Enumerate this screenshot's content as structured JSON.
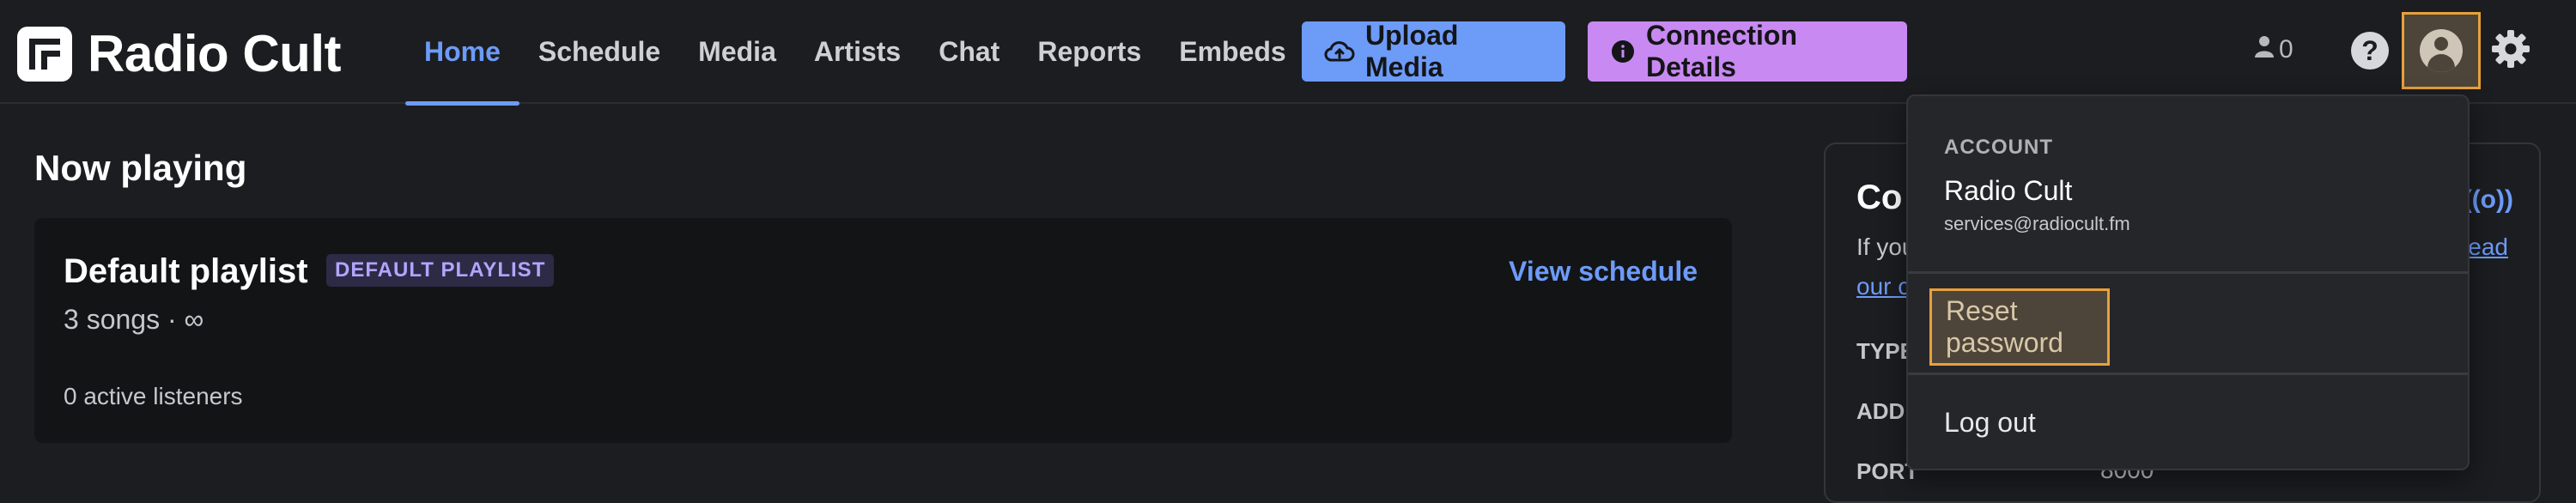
{
  "app": {
    "name": "Radio Cult"
  },
  "nav": [
    {
      "label": "Home",
      "active": true
    },
    {
      "label": "Schedule",
      "active": false
    },
    {
      "label": "Media",
      "active": false
    },
    {
      "label": "Artists",
      "active": false
    },
    {
      "label": "Chat",
      "active": false
    },
    {
      "label": "Reports",
      "active": false
    },
    {
      "label": "Embeds",
      "active": false
    }
  ],
  "actions": {
    "upload_label": "Upload Media",
    "connection_label": "Connection Details"
  },
  "header": {
    "listener_count": "0"
  },
  "now_playing": {
    "heading": "Now playing",
    "playlist_title": "Default playlist",
    "badge": "DEFAULT PLAYLIST",
    "songs": "3 songs · ∞",
    "listeners": "0 active listeners",
    "view_schedule": "View schedule"
  },
  "connection_card": {
    "title": "Co",
    "text_start": "If you",
    "link_end": "ead",
    "link_start": "our c",
    "rows": [
      {
        "label": "TYPE",
        "value": ""
      },
      {
        "label": "ADD",
        "value": ""
      },
      {
        "label": "PORT",
        "value": "8000"
      }
    ]
  },
  "account_menu": {
    "header": "ACCOUNT",
    "name": "Radio Cult",
    "email": "services@radiocult.fm",
    "reset_label": "Reset password",
    "logout_label": "Log out"
  },
  "colors": {
    "accent": "#6d9bf8",
    "connection": "#c889f2",
    "highlight": "#e8a13b"
  }
}
